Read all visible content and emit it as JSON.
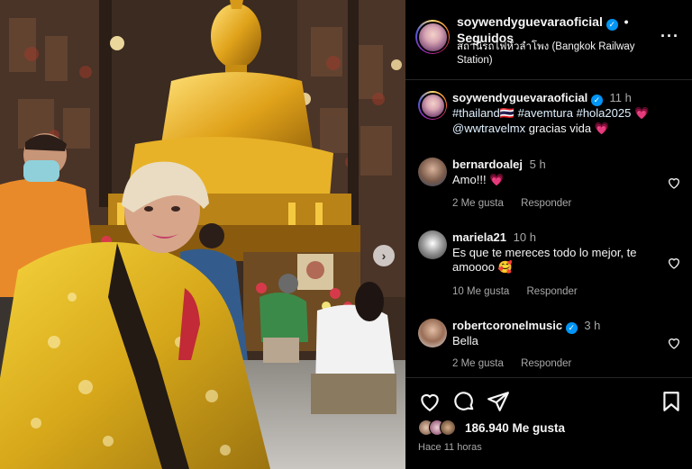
{
  "post": {
    "author": "soywendyguevaraoficial",
    "follow_status": "Seguidos",
    "location": "สถานีรถไฟหัวลำโพง (Bangkok Railway Station)",
    "separator": "•",
    "more": "···"
  },
  "caption": {
    "username": "soywendyguevaraoficial",
    "time": "11 h",
    "text_tags": "#thailand🇹🇭 #avemtura #hola2025",
    "text_emoji1": "💗",
    "text_mention": "@wwtravelmx",
    "text_rest": "gracias vida",
    "text_emoji2": "💗"
  },
  "comments": [
    {
      "username": "bernardoalej",
      "time": "5 h",
      "text": "Amo!!! 💗",
      "likes": "2 Me gusta",
      "reply": "Responder"
    },
    {
      "username": "mariela21",
      "time": "10 h",
      "text": "Es que te mereces todo lo mejor, te amoooo 🥰",
      "likes": "10 Me gusta",
      "reply": "Responder"
    },
    {
      "username": "robertcoronelmusic",
      "time": "3 h",
      "text": "Bella",
      "likes": "2 Me gusta",
      "reply": "Responder"
    }
  ],
  "engagement": {
    "likes": "186.940 Me gusta",
    "posted": "Hace 11 horas"
  },
  "icons": {
    "verified": "✓",
    "next": "›"
  },
  "colors": {
    "background": "#000000",
    "text": "#f5f5f5",
    "muted": "#a8a8a8",
    "verified": "#0095f6",
    "divider": "#262626"
  }
}
